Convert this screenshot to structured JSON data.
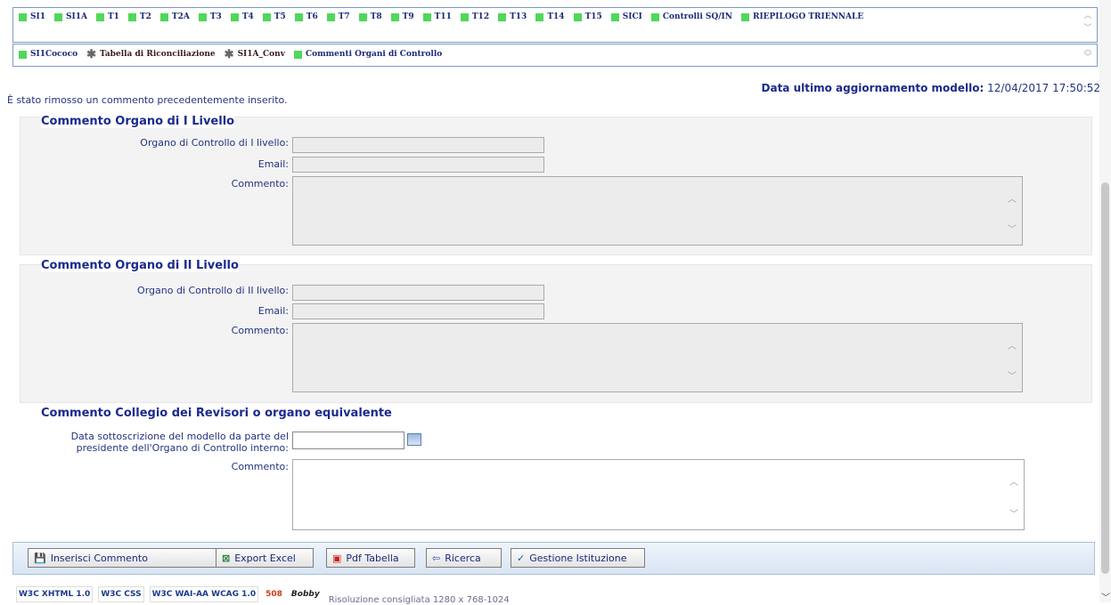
{
  "tabs_row1": [
    {
      "label": "SI1",
      "icon": "green-square"
    },
    {
      "label": "SI1A",
      "icon": "green-square"
    },
    {
      "label": "T1",
      "icon": "green-square"
    },
    {
      "label": "T2",
      "icon": "green-square"
    },
    {
      "label": "T2A",
      "icon": "green-square"
    },
    {
      "label": "T3",
      "icon": "green-square"
    },
    {
      "label": "T4",
      "icon": "green-square"
    },
    {
      "label": "T5",
      "icon": "green-square"
    },
    {
      "label": "T6",
      "icon": "green-square"
    },
    {
      "label": "T7",
      "icon": "green-square"
    },
    {
      "label": "T8",
      "icon": "green-square"
    },
    {
      "label": "T9",
      "icon": "green-square"
    },
    {
      "label": "T11",
      "icon": "green-square"
    },
    {
      "label": "T12",
      "icon": "green-square"
    },
    {
      "label": "T13",
      "icon": "green-square"
    },
    {
      "label": "T14",
      "icon": "green-square"
    },
    {
      "label": "T15",
      "icon": "green-square"
    },
    {
      "label": "SICI",
      "icon": "green-square"
    },
    {
      "label": "Controlli SQ/IN",
      "icon": "green-square"
    },
    {
      "label": "RIEPILOGO TRIENNALE",
      "icon": "green-square"
    }
  ],
  "tabs_row2": [
    {
      "label": "SI1Cococo",
      "icon": "green-square"
    },
    {
      "label": "Tabella di Riconciliazione",
      "icon": "star"
    },
    {
      "label": "SI1A_Conv",
      "icon": "star"
    },
    {
      "label": "Commenti Organi di Controllo",
      "icon": "green-square"
    }
  ],
  "notice": "È stato rimosso un commento precedentemente inserito.",
  "updated": {
    "label": "Data ultimo aggiornamento modello:",
    "value": " 12/04/2017 17:50:52"
  },
  "section1": {
    "title": "Commento Organo di I Livello",
    "organo_label": "Organo di Controllo di I livello:",
    "email_label": "Email:",
    "commento_label": "Commento:"
  },
  "section2": {
    "title": "Commento Organo di II Livello",
    "organo_label": "Organo di Controllo di II livello:",
    "email_label": "Email:",
    "commento_label": "Commento:"
  },
  "section3": {
    "title": "Commento Collegio dei Revisori o organo equivalente",
    "date_label_1": "Data sottoscrizione del modello da parte del",
    "date_label_2": "presidente dell'Organo di Controllo interno:",
    "commento_label": "Commento:"
  },
  "buttons": {
    "inserisci": "Inserisci Commento",
    "excel": "Export Excel",
    "pdf": "Pdf Tabella",
    "ricerca": "Ricerca",
    "gestione": "Gestione Istituzione"
  },
  "footer": {
    "badges": [
      "W3C XHTML 1.0",
      "W3C CSS",
      "W3C WAI-AA WCAG 1.0",
      "508",
      "Bobby"
    ],
    "text": "Risoluzione consigliata 1280 x 768-1024"
  }
}
